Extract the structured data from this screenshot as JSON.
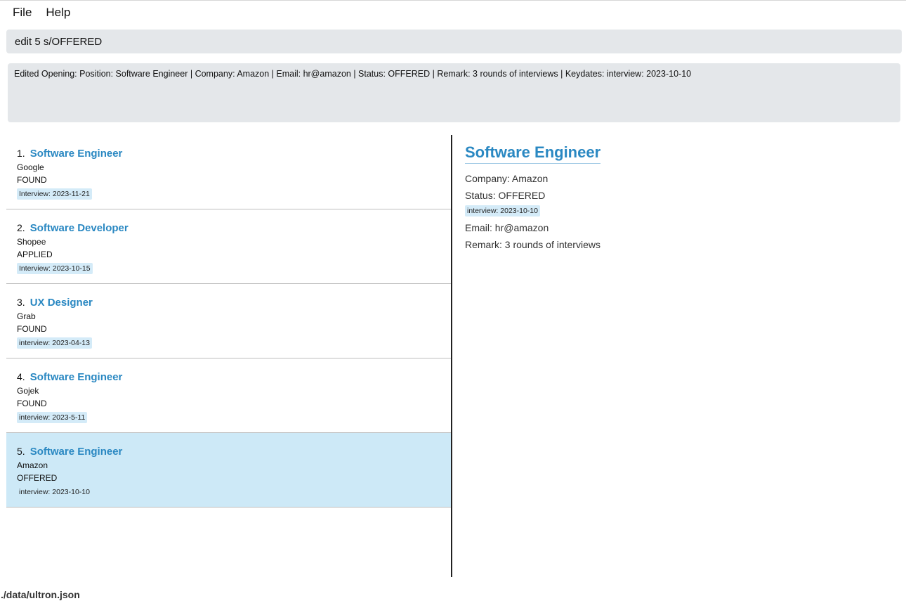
{
  "menu": {
    "file_label": "File",
    "help_label": "Help"
  },
  "command": {
    "value": "edit 5 s/OFFERED"
  },
  "result": {
    "text": "Edited Opening: Position: Software Engineer | Company: Amazon | Email: hr@amazon | Status: OFFERED | Remark: 3 rounds of interviews | Keydates: interview: 2023-10-10"
  },
  "openings": [
    {
      "index": "1.",
      "title": "Software Engineer",
      "company": "Google",
      "status": "FOUND",
      "keydate": "Interview: 2023-11-21"
    },
    {
      "index": "2.",
      "title": "Software Developer",
      "company": "Shopee",
      "status": "APPLIED",
      "keydate": "Interview: 2023-10-15"
    },
    {
      "index": "3.",
      "title": "UX Designer",
      "company": "Grab",
      "status": "FOUND",
      "keydate": "interview: 2023-04-13"
    },
    {
      "index": "4.",
      "title": "Software Engineer",
      "company": "Gojek",
      "status": "FOUND",
      "keydate": "interview: 2023-5-11"
    },
    {
      "index": "5.",
      "title": "Software Engineer",
      "company": "Amazon",
      "status": "OFFERED",
      "keydate": "interview: 2023-10-10"
    }
  ],
  "detail": {
    "title": "Software Engineer",
    "company": "Company: Amazon",
    "status": "Status: OFFERED",
    "keydate": "interview: 2023-10-10",
    "email": "Email: hr@amazon",
    "remark": "Remark: 3 rounds of interviews"
  },
  "status_bar": {
    "path": "./data/ultron.json"
  },
  "colors": {
    "accent": "#2a88c2",
    "selected_row": "#cde9f7",
    "tag_bg": "#d4ebf8",
    "box_bg": "#e4e7ea"
  }
}
